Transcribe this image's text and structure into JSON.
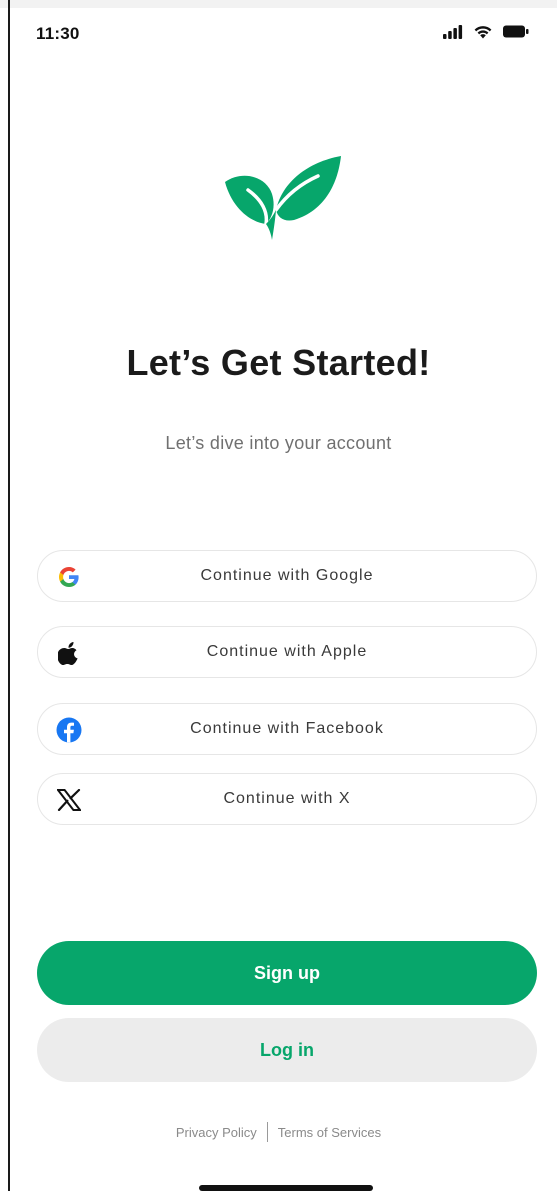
{
  "status_bar": {
    "time": "11:30",
    "icons": [
      "signal-icon",
      "wifi-icon",
      "battery-icon"
    ]
  },
  "brand": {
    "logo_icon": "leaf-sprout-icon",
    "accent_color": "#07a66b"
  },
  "header": {
    "title": "Let’s Get Started!",
    "subtitle": "Let’s dive into your account"
  },
  "social_buttons": [
    {
      "label": "Continue with Google",
      "icon": "google-icon"
    },
    {
      "label": "Continue with Apple",
      "icon": "apple-icon"
    },
    {
      "label": "Continue with Facebook",
      "icon": "facebook-icon"
    },
    {
      "label": "Continue with X",
      "icon": "x-icon"
    }
  ],
  "actions": {
    "signup_label": "Sign up",
    "login_label": "Log in"
  },
  "footer": {
    "privacy_label": "Privacy Policy",
    "terms_label": "Terms of Services"
  }
}
